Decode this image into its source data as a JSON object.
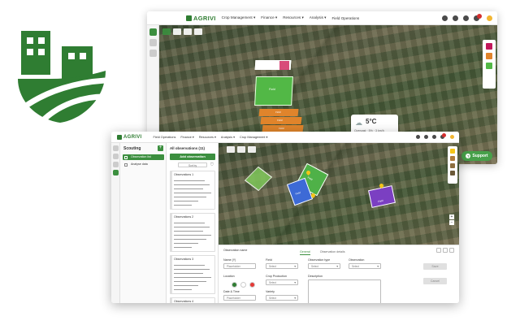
{
  "colors": {
    "brand": "#3c8f3f",
    "accent_orange": "#e0842b",
    "accent_blue": "#3d6ad6",
    "accent_purple": "#7b3fc2",
    "accent_magenta": "#c2185b"
  },
  "back_window": {
    "logo": "AGRIVI",
    "nav": [
      "Crop Management ▾",
      "Finance ▾",
      "Resources ▾",
      "Analysis ▾",
      "Field Operations"
    ],
    "icons": [
      "help-icon",
      "calendar-icon",
      "bell-icon",
      "notifications-icon",
      "user-icon"
    ],
    "weather": {
      "temp": "5°C",
      "meta": "Overcast · 5% · 3 km/h"
    },
    "support_label": "Support",
    "field_labels": {
      "green": "Field",
      "orange_1": "Field",
      "orange_2": "Field",
      "orange_3": "Field"
    }
  },
  "front_window": {
    "logo": "AGRIVI",
    "nav": [
      "Field Operations",
      "Finance ▾",
      "Resources ▾",
      "Analysis ▾",
      "Crop Management ▾"
    ],
    "scouting": {
      "title": "Scouting",
      "items": [
        {
          "label": "Observation list",
          "active": true
        },
        {
          "label": "Analyse data",
          "active": false
        }
      ]
    },
    "observations": {
      "heading": "All observations (11)",
      "add_button": "Add observation",
      "sort_label": "Sort by",
      "cards": [
        "Observations 1",
        "Observations 2",
        "Observations 3",
        "Observations 4"
      ]
    },
    "map_field_labels": [
      "Field",
      "Field",
      "Field"
    ],
    "form": {
      "heading": "Observation name",
      "tabs": [
        "General",
        "Observation details"
      ],
      "fields": {
        "name_label": "Name (Y)",
        "name_placeholder": "Placeholder",
        "field_label": "Field",
        "field_value": "Select",
        "obs_type_label": "Observation type",
        "obs_type_value": "Select",
        "observation_label": "Observation",
        "observation_value": "Select",
        "location_label": "Location",
        "crop_label": "Crop Production",
        "crop_value": "Select",
        "date_label": "Date & Time",
        "date_value": "Placeholder",
        "variety_label": "Variety",
        "variety_value": "Select",
        "description_label": "Description"
      },
      "buttons": {
        "save": "Save",
        "cancel": "Cancel"
      }
    }
  }
}
